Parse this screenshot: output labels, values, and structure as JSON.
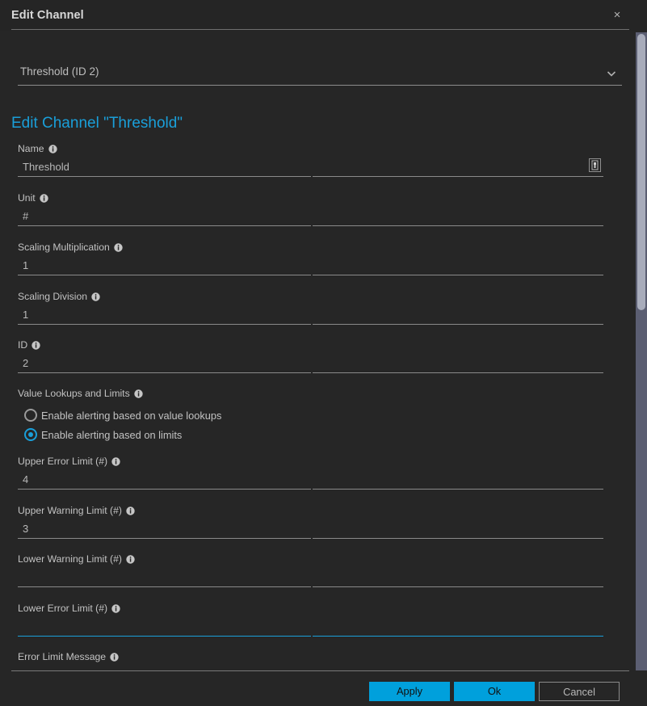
{
  "titlebar": {
    "title": "Edit Channel",
    "close_label": "×"
  },
  "channel_selector": {
    "selected": "Threshold (ID 2)",
    "icon": "chevron-down-icon"
  },
  "heading": "Edit Channel \"Threshold\"",
  "info_icon_name": "info-icon",
  "fields": [
    {
      "label": "Name",
      "value": "Threshold",
      "focused": false,
      "trailing_icon": "placeholder-insert-icon"
    },
    {
      "label": "Unit",
      "value": "#",
      "focused": false
    },
    {
      "label": "Scaling Multiplication",
      "value": "1",
      "focused": false
    },
    {
      "label": "Scaling Division",
      "value": "1",
      "focused": false
    },
    {
      "label": "ID",
      "value": "2",
      "focused": false
    }
  ],
  "value_lookups": {
    "label": "Value Lookups and Limits",
    "options": [
      {
        "label": "Enable alerting based on value lookups",
        "selected": false
      },
      {
        "label": "Enable alerting based on limits",
        "selected": true
      }
    ]
  },
  "limit_fields": [
    {
      "label": "Upper Error Limit (#)",
      "value": "4",
      "focused": false
    },
    {
      "label": "Upper Warning Limit (#)",
      "value": "3",
      "focused": false
    },
    {
      "label": "Lower Warning Limit (#)",
      "value": "",
      "focused": false
    },
    {
      "label": "Lower Error Limit (#)",
      "value": "",
      "focused": true
    },
    {
      "label": "Error Limit Message",
      "value": "",
      "focused": false
    }
  ],
  "footer": {
    "apply_label": "Apply",
    "ok_label": "Ok",
    "cancel_label": "Cancel"
  },
  "colors": {
    "accent": "#1a9fd9",
    "button_primary": "#00a0dc",
    "background": "#262626",
    "titlebar": "#252525",
    "text": "#c2c2c2",
    "underline": "#8a8a8a",
    "scrollbar_thumb": "#a8acbb",
    "scrollbar_track": "#5b5e72"
  }
}
